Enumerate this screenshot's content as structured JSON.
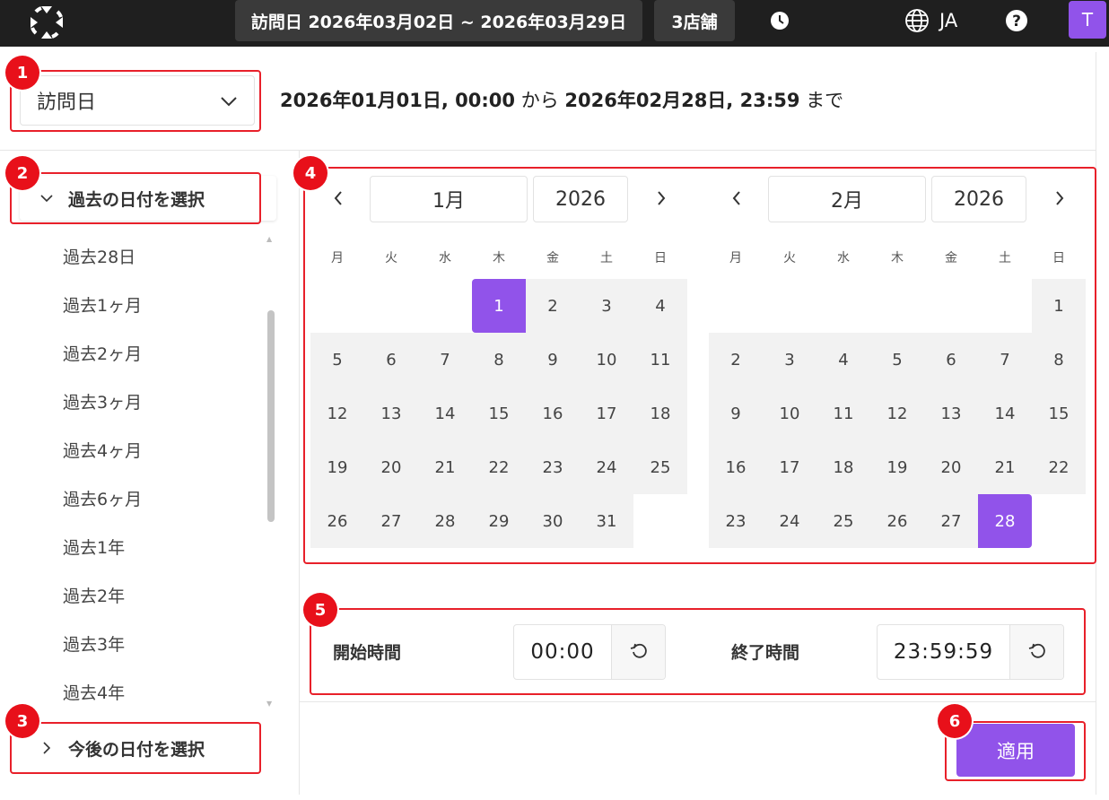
{
  "topbar": {
    "date_range": "訪問日 2026年03月02日 ~ 2026年03月29日",
    "store_count": "3店舗",
    "language": "JA",
    "avatar_initial": "T"
  },
  "filter": {
    "type_selected": "訪問日",
    "range_start_date": "2026年01月01日, 00:00",
    "range_from": "から",
    "range_end_date": "2026年02月28日, 23:59",
    "range_to": "まで"
  },
  "sidebar": {
    "past_section_label": "過去の日付を選択",
    "future_section_label": "今後の日付を選択",
    "past_items": [
      "過去28日",
      "過去1ヶ月",
      "過去2ヶ月",
      "過去3ヶ月",
      "過去4ヶ月",
      "過去6ヶ月",
      "過去1年",
      "過去2年",
      "過去3年",
      "過去4年"
    ]
  },
  "calendar": {
    "weekdays": [
      "月",
      "火",
      "水",
      "木",
      "金",
      "土",
      "日"
    ],
    "left": {
      "month": "1月",
      "year": "2026",
      "first_weekday_index": 3,
      "days": 31,
      "selected_day": "1"
    },
    "right": {
      "month": "2月",
      "year": "2026",
      "first_weekday_index": 6,
      "days": 28,
      "selected_day": "28"
    }
  },
  "time": {
    "start_label": "開始時間",
    "start_value": "00:00",
    "end_label": "終了時間",
    "end_value": "23:59:59"
  },
  "apply_label": "適用",
  "annotations": [
    "1",
    "2",
    "3",
    "4",
    "5",
    "6"
  ],
  "colors": {
    "accent": "#9153ea",
    "annotation": "#e8101a",
    "topbar": "#1f1f1f"
  }
}
